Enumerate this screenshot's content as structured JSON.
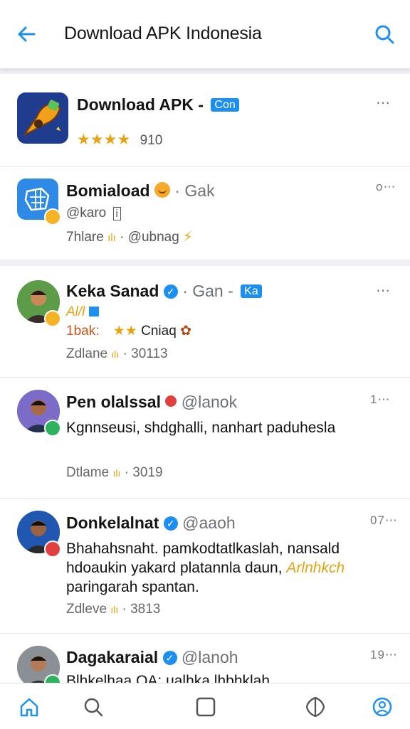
{
  "header": {
    "title": "Download APK Indonesia"
  },
  "app_card": {
    "name": "Download APK -",
    "badge": "Con",
    "stars": "★★★★",
    "rating": "910"
  },
  "second_card": {
    "name": "Bomiaload",
    "sub": "· Gak",
    "handle": "@karo",
    "handle_mark": "i",
    "meta": "7hlare",
    "meta2": "· @ubnag",
    "dots": "⋯"
  },
  "posts": [
    {
      "name": "Keka Sanad",
      "sub": "· Gan -",
      "badge": "Ka",
      "line1": "Al/l",
      "line2a": "1bak:",
      "line2b": "★★",
      "line2c": "Cniaq",
      "meta": "Zdlane",
      "meta2": "· 30113",
      "dots": "⋯"
    },
    {
      "name": "Pen olalssal",
      "handle": "@lanok",
      "time": "1⋯",
      "text": "Kgnnseusi, shdghalli, nanhart paduhesla",
      "meta": "Dtlame",
      "meta2": "· 3019"
    },
    {
      "name": "Donkelalnat",
      "handle": "@aaoh",
      "time": "07⋯",
      "text1": "Bhahahsnaht. pamkodtatlkaslah, nansald",
      "text2": "hdoaukin yakard platannla daun,",
      "text2b": "Arlnhkch",
      "text3": "paringarah spantan.",
      "meta": "Zdleve",
      "meta2": "· 3813"
    },
    {
      "name": "Dagakaraial",
      "handle": "@lanoh",
      "time": "19⋯",
      "text": "Blhkelhaa OA: ualhka lhbhklah"
    }
  ],
  "icons": [
    "back-arrow-icon",
    "search-icon",
    "home-icon",
    "search-nav-icon",
    "square-icon",
    "shield-icon",
    "profile-icon"
  ],
  "colors": {
    "accent": "#1d8ff1",
    "star": "#e5a313"
  }
}
